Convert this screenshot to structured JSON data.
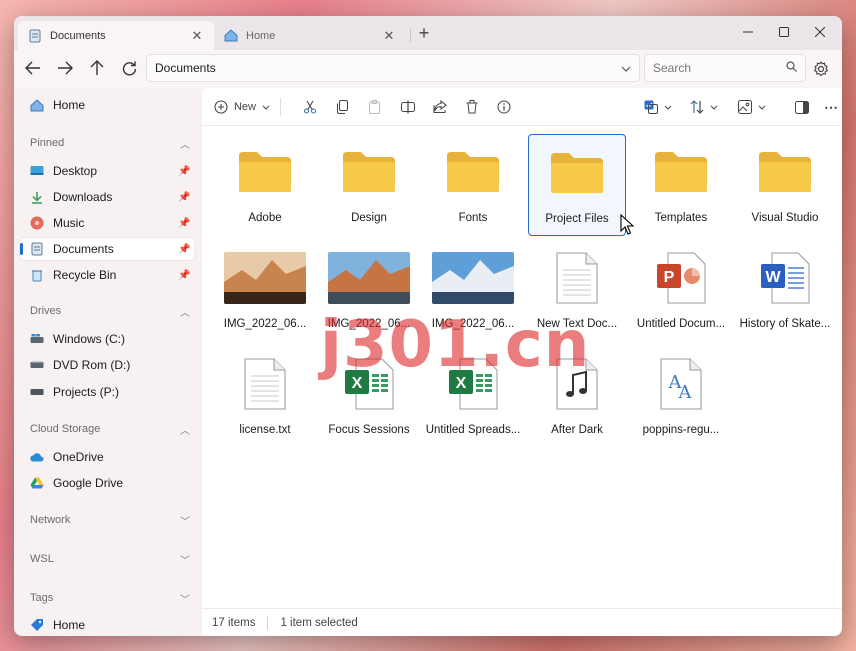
{
  "tabs": [
    {
      "label": "Documents",
      "icon": "documents-icon"
    },
    {
      "label": "Home",
      "icon": "home-icon"
    }
  ],
  "nav": {
    "address": "Documents",
    "search_placeholder": "Search"
  },
  "sidebar": {
    "home": "Home",
    "pinned_header": "Pinned",
    "pinned": [
      {
        "label": "Desktop",
        "icon": "desktop-icon"
      },
      {
        "label": "Downloads",
        "icon": "download-icon"
      },
      {
        "label": "Music",
        "icon": "music-icon"
      },
      {
        "label": "Documents",
        "icon": "documents-icon"
      },
      {
        "label": "Recycle Bin",
        "icon": "recycle-bin-icon"
      }
    ],
    "drives_header": "Drives",
    "drives": [
      {
        "label": "Windows (C:)",
        "icon": "windows-drive-icon"
      },
      {
        "label": "DVD Rom (D:)",
        "icon": "dvd-drive-icon"
      },
      {
        "label": "Projects (P:)",
        "icon": "drive-icon"
      }
    ],
    "cloud_header": "Cloud Storage",
    "cloud": [
      {
        "label": "OneDrive",
        "icon": "onedrive-icon"
      },
      {
        "label": "Google Drive",
        "icon": "google-drive-icon"
      }
    ],
    "network_header": "Network",
    "wsl_header": "WSL",
    "tags_header": "Tags",
    "tags": [
      {
        "label": "Home",
        "icon": "tag-icon"
      }
    ]
  },
  "toolbar": {
    "new_label": "New"
  },
  "files": [
    {
      "name": "Adobe",
      "type": "folder"
    },
    {
      "name": "Design",
      "type": "folder"
    },
    {
      "name": "Fonts",
      "type": "folder"
    },
    {
      "name": "Project Files",
      "type": "folder"
    },
    {
      "name": "Templates",
      "type": "folder"
    },
    {
      "name": "Visual Studio",
      "type": "folder"
    },
    {
      "name": "IMG_2022_06...",
      "type": "image"
    },
    {
      "name": "IMG_2022_06...",
      "type": "image"
    },
    {
      "name": "IMG_2022_06...",
      "type": "image"
    },
    {
      "name": "New Text Doc...",
      "type": "text"
    },
    {
      "name": "Untitled Docum...",
      "type": "powerpoint"
    },
    {
      "name": "History of Skate...",
      "type": "word"
    },
    {
      "name": "license.txt",
      "type": "text"
    },
    {
      "name": "Focus Sessions",
      "type": "excel"
    },
    {
      "name": "Untitled Spreads...",
      "type": "excel"
    },
    {
      "name": "After Dark",
      "type": "audio"
    },
    {
      "name": "poppins-regu...",
      "type": "font"
    }
  ],
  "status": {
    "items": "17 items",
    "selected": "1 item selected"
  },
  "watermark": "j301.cn",
  "colors": {
    "accent": "#1d6fd6",
    "folder": "#f7c948",
    "excel": "#1f7a44",
    "word": "#2b5fbf",
    "powerpoint": "#c8462b"
  }
}
